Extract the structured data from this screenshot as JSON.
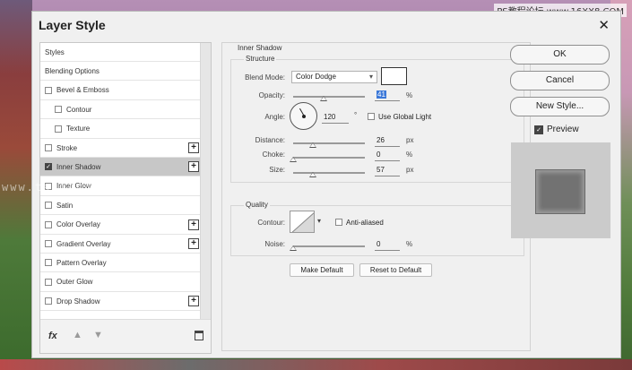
{
  "watermark": "PS教程论坛 www.16XX8.COM",
  "overlay_watermark": "www.tatiacollect.com",
  "dialog": {
    "title": "Layer Style",
    "close_label": "✕"
  },
  "styles_list": [
    {
      "label": "Styles",
      "checkbox": false,
      "checked": false,
      "plus": false,
      "indent": false,
      "selected": false
    },
    {
      "label": "Blending Options",
      "checkbox": false,
      "checked": false,
      "plus": false,
      "indent": false,
      "selected": false
    },
    {
      "label": "Bevel & Emboss",
      "checkbox": true,
      "checked": false,
      "plus": false,
      "indent": false,
      "selected": false
    },
    {
      "label": "Contour",
      "checkbox": true,
      "checked": false,
      "plus": false,
      "indent": true,
      "selected": false
    },
    {
      "label": "Texture",
      "checkbox": true,
      "checked": false,
      "plus": false,
      "indent": true,
      "selected": false
    },
    {
      "label": "Stroke",
      "checkbox": true,
      "checked": false,
      "plus": true,
      "indent": false,
      "selected": false
    },
    {
      "label": "Inner Shadow",
      "checkbox": true,
      "checked": true,
      "plus": true,
      "indent": false,
      "selected": true
    },
    {
      "label": "Inner Glow",
      "checkbox": true,
      "checked": false,
      "plus": false,
      "indent": false,
      "selected": false
    },
    {
      "label": "Satin",
      "checkbox": true,
      "checked": false,
      "plus": false,
      "indent": false,
      "selected": false
    },
    {
      "label": "Color Overlay",
      "checkbox": true,
      "checked": false,
      "plus": true,
      "indent": false,
      "selected": false
    },
    {
      "label": "Gradient Overlay",
      "checkbox": true,
      "checked": false,
      "plus": true,
      "indent": false,
      "selected": false
    },
    {
      "label": "Pattern Overlay",
      "checkbox": true,
      "checked": false,
      "plus": false,
      "indent": false,
      "selected": false
    },
    {
      "label": "Outer Glow",
      "checkbox": true,
      "checked": false,
      "plus": false,
      "indent": false,
      "selected": false
    },
    {
      "label": "Drop Shadow",
      "checkbox": true,
      "checked": false,
      "plus": true,
      "indent": false,
      "selected": false
    }
  ],
  "footer": {
    "fx_label": "fx",
    "move_up_icon": "arrow-up-icon",
    "move_down_icon": "arrow-down-icon",
    "delete_icon": "trash-icon"
  },
  "inner_shadow": {
    "section_title": "Inner Shadow",
    "structure_title": "Structure",
    "blend_mode_label": "Blend Mode:",
    "blend_mode_value": "Color Dodge",
    "blend_color": "#ffffff",
    "opacity_label": "Opacity:",
    "opacity_value": "41",
    "opacity_unit": "%",
    "angle_label": "Angle:",
    "angle_value": "120",
    "angle_unit": "°",
    "use_global_light_label": "Use Global Light",
    "use_global_light_checked": false,
    "distance_label": "Distance:",
    "distance_value": "26",
    "distance_unit": "px",
    "choke_label": "Choke:",
    "choke_value": "0",
    "choke_unit": "%",
    "size_label": "Size:",
    "size_value": "57",
    "size_unit": "px",
    "quality_title": "Quality",
    "contour_label": "Contour:",
    "anti_aliased_label": "Anti-aliased",
    "anti_aliased_checked": false,
    "noise_label": "Noise:",
    "noise_value": "0",
    "noise_unit": "%",
    "make_default_label": "Make Default",
    "reset_default_label": "Reset to Default"
  },
  "right_panel": {
    "ok_label": "OK",
    "cancel_label": "Cancel",
    "new_style_label": "New Style...",
    "preview_label": "Preview",
    "preview_checked": true
  }
}
